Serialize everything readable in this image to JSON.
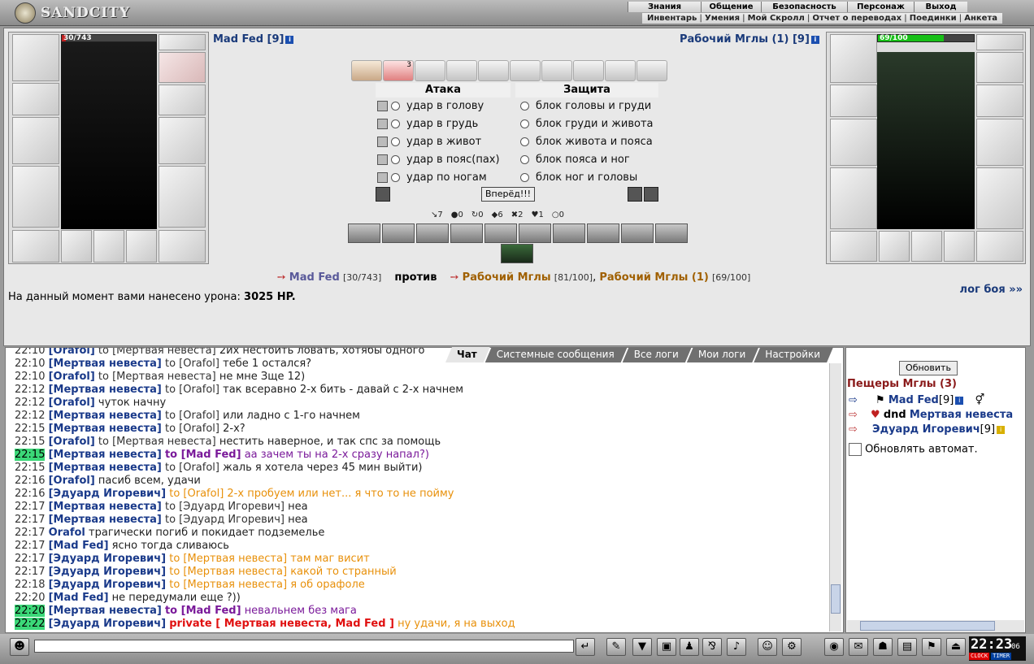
{
  "app": {
    "logo_text": "SANDCITY"
  },
  "main_menu": [
    "Знания",
    "Общение",
    "Безопасность",
    "Персонаж",
    "Выход"
  ],
  "sub_menu": [
    "Инвентарь",
    "Умения",
    "Мой Скролл",
    "Отчет о переводах",
    "Поединки",
    "Анкета"
  ],
  "player": {
    "name": "Mad Fed [9]",
    "hp_text": "30/743",
    "hp_fraction": 0.04
  },
  "enemy": {
    "name": "Рабочий Мглы (1) [9]",
    "hp_text": "69/100",
    "hp_fraction": 0.69
  },
  "combat": {
    "attack_title": "Атака",
    "defense_title": "Защита",
    "attacks": [
      "удар в голову",
      "удар в грудь",
      "удар в живот",
      "удар в пояс(пах)",
      "удар по ногам"
    ],
    "blocks": [
      "блок головы и груди",
      "блок груди и живота",
      "блок живота и пояса",
      "блок пояса и ног",
      "блок ног и головы"
    ],
    "go_button": "Вперёд!!!",
    "scroll_badge": "3",
    "stats": [
      "7",
      "0",
      "0",
      "6",
      "2",
      "1",
      "0"
    ]
  },
  "versus": {
    "player_name": "Mad Fed",
    "player_hp": "[30/743]",
    "vs": "против",
    "enemy1_name": "Рабочий Мглы",
    "enemy1_hp": "[81/100]",
    "comma": ",",
    "enemy2_name": "Рабочий Мглы (1)",
    "enemy2_hp": "[69/100]"
  },
  "damage": {
    "label": "На данный момент вами нанесено урона:",
    "value": "3025 HP."
  },
  "log_link": "лог боя »»",
  "chat_tabs": [
    "Чат",
    "Системные сообщения",
    "Все логи",
    "Мои логи",
    "Настройки"
  ],
  "chat": [
    {
      "time": "22:10",
      "nick": "[Orafol]",
      "to": "to [Мертвая невеста]",
      "text": "2их нестоить ловать, хотябы одного",
      "hl": false,
      "style": ""
    },
    {
      "time": "22:10",
      "nick": "[Мертвая невеста]",
      "to": "to [Orafol]",
      "text": "тебе 1 остался?",
      "hl": false,
      "style": ""
    },
    {
      "time": "22:10",
      "nick": "[Orafol]",
      "to": "to [Мертвая невеста]",
      "text": "не мне Зще 12)",
      "hl": false,
      "style": ""
    },
    {
      "time": "22:12",
      "nick": "[Мертвая невеста]",
      "to": "to [Orafol]",
      "text": "так всеравно 2-х бить - давай с 2-х начнем",
      "hl": false,
      "style": ""
    },
    {
      "time": "22:12",
      "nick": "[Orafol]",
      "to": "",
      "text": "чуток начну",
      "hl": false,
      "style": ""
    },
    {
      "time": "22:12",
      "nick": "[Мертвая невеста]",
      "to": "to [Orafol]",
      "text": "или ладно с 1-го начнем",
      "hl": false,
      "style": ""
    },
    {
      "time": "22:15",
      "nick": "[Мертвая невеста]",
      "to": "to [Orafol]",
      "text": "2-х?",
      "hl": false,
      "style": ""
    },
    {
      "time": "22:15",
      "nick": "[Orafol]",
      "to": "to [Мертвая невеста]",
      "text": "нестить наверное, и так спс за помощь",
      "hl": false,
      "style": ""
    },
    {
      "time": "22:15",
      "nick": "[Мертвая невеста]",
      "to": "to [Mad Fed]",
      "text": "аа зачем ты на 2-х сразу напал?)",
      "hl": true,
      "style": "purple"
    },
    {
      "time": "22:15",
      "nick": "[Мертвая невеста]",
      "to": "to [Orafol]",
      "text": "жаль я хотела через 45 мин выйти)",
      "hl": false,
      "style": ""
    },
    {
      "time": "22:16",
      "nick": "[Orafol]",
      "to": "",
      "text": "пасиб всем, удачи",
      "hl": false,
      "style": ""
    },
    {
      "time": "22:16",
      "nick": "[Эдуард Игоревич]",
      "to": "to [Orafol]",
      "text": "2-х пробуем или нет... я что то не пойму",
      "hl": false,
      "style": "orange"
    },
    {
      "time": "22:17",
      "nick": "[Мертвая невеста]",
      "to": "to [Эдуард Игоревич]",
      "text": "неа",
      "hl": false,
      "style": ""
    },
    {
      "time": "22:17",
      "nick": "[Мертвая невеста]",
      "to": "to [Эдуард Игоревич]",
      "text": "неа",
      "hl": false,
      "style": ""
    },
    {
      "time": "22:17",
      "nick": "Orafol",
      "to": "",
      "text": "трагически погиб и покидает подземелье",
      "hl": false,
      "style": "system"
    },
    {
      "time": "22:17",
      "nick": "[Mad Fed]",
      "to": "",
      "text": "ясно тогда сливаюсь",
      "hl": false,
      "style": ""
    },
    {
      "time": "22:17",
      "nick": "[Эдуард Игоревич]",
      "to": "to [Мертвая невеста]",
      "text": "там маг висит",
      "hl": false,
      "style": "orange"
    },
    {
      "time": "22:17",
      "nick": "[Эдуард Игоревич]",
      "to": "to [Мертвая невеста]",
      "text": "какой то странный",
      "hl": false,
      "style": "orange"
    },
    {
      "time": "22:18",
      "nick": "[Эдуард Игоревич]",
      "to": "to [Мертвая невеста]",
      "text": "я об орафоле",
      "hl": false,
      "style": "orange"
    },
    {
      "time": "22:20",
      "nick": "[Mad Fed]",
      "to": "",
      "text": "не передумали еще ?))",
      "hl": false,
      "style": ""
    },
    {
      "time": "22:20",
      "nick": "[Мертвая невеста]",
      "to": "to [Mad Fed]",
      "text": "невальнем без мага",
      "hl": true,
      "style": "purple"
    },
    {
      "time": "22:22",
      "nick": "[Эдуард Игоревич]",
      "to": "private [ Мертвая невеста, Mad Fed ]",
      "text": "ну удачи, я на выход",
      "hl": true,
      "style": "private"
    }
  ],
  "room": {
    "refresh_button": "Обновить",
    "title": "Пещеры Мглы (3)",
    "members": [
      {
        "prefix": "",
        "name": "Mad Fed",
        "level": "[9]"
      },
      {
        "prefix": "dnd",
        "name": "Мертвая невеста",
        "level": ""
      },
      {
        "prefix": "",
        "name": "Эдуард Игоревич",
        "level": "[9]"
      }
    ],
    "auto_refresh_label": "Обновлять автомат."
  },
  "clock": {
    "time": "22:23",
    "seconds": "06",
    "clock_label": "CLOCK",
    "timer_label": "TIMER"
  },
  "colors": {
    "accent": "#1a3a8a",
    "highlight": "#3bd878",
    "private": "#e01010",
    "hp_red": "#c02020",
    "hp_green": "#18c018"
  }
}
